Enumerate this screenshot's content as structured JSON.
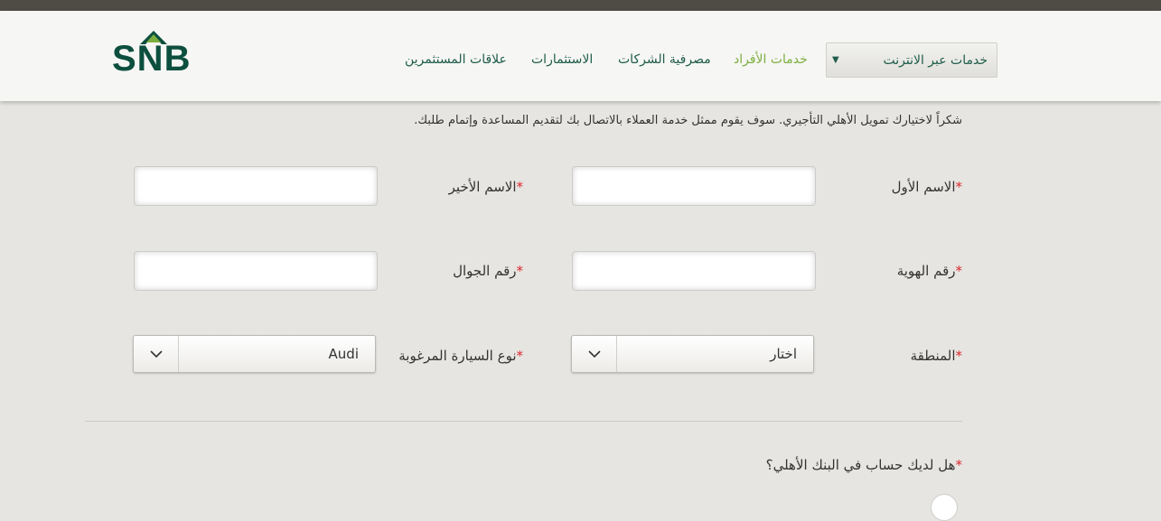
{
  "header": {
    "logo_text": "SNB",
    "nav": [
      {
        "label": "خدمات الأفراد",
        "active": true
      },
      {
        "label": "مصرفية الشركات",
        "active": false
      },
      {
        "label": "الاستثمارات",
        "active": false
      },
      {
        "label": "علاقات المستثمرين",
        "active": false
      }
    ],
    "online_services": "خدمات عبر الانترنت",
    "dropdown_icon": "triangle-down-icon"
  },
  "form": {
    "intro": "شكراً لاختيارك تمويل الأهلي التأجيري. سوف يقوم ممثل خدمة العملاء بالاتصال بك لتقديم المساعدة وإتمام طلبك.",
    "required_mark": "*",
    "first_name": {
      "label": "الاسم الأول",
      "value": ""
    },
    "last_name": {
      "label": "الاسم الأخير",
      "value": ""
    },
    "id_number": {
      "label": "رقم الهوية",
      "value": ""
    },
    "mobile": {
      "label": "رقم الجوال",
      "value": ""
    },
    "region": {
      "label": "المنطقة",
      "selected": "اختار"
    },
    "car_type": {
      "label": "نوع السيارة المرغوبة",
      "selected": "Audi"
    },
    "account_question": "هل لديك حساب في البنك الأهلي؟"
  },
  "colors": {
    "brand_green": "#0d4f3e",
    "nav_text": "#1e5c4a",
    "active_nav": "#7cae3f",
    "required": "#d8282f"
  }
}
